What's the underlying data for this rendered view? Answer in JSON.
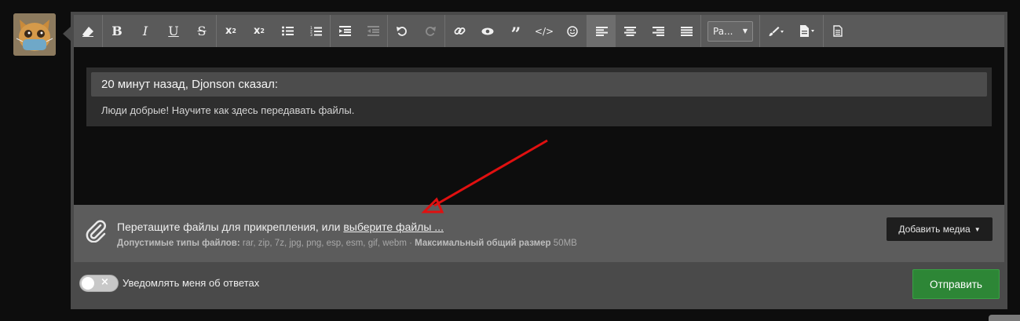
{
  "toolbar": {
    "paragraph_select": "Pa...",
    "icons": [
      "eraser-icon",
      "bold-icon",
      "italic-icon",
      "underline-icon",
      "strikethrough-icon",
      "superscript-icon",
      "subscript-icon",
      "bullet-list-icon",
      "numbered-list-icon",
      "indent-icon",
      "outdent-icon",
      "undo-icon",
      "redo-icon",
      "link-icon",
      "preview-icon",
      "quote-icon",
      "code-icon",
      "smiley-icon",
      "align-left-icon",
      "align-center-icon",
      "align-right-icon",
      "justify-icon",
      "paragraph-select",
      "brush-icon",
      "insert-icon",
      "document-icon"
    ]
  },
  "quote": {
    "header": "20 минут назад, Djonson сказал:",
    "body": "Люди добрые! Научите как здесь передавать файлы."
  },
  "attach": {
    "drag_text": "Перетащите файлы для прикрепления, или ",
    "choose_link": "выберите файлы ...",
    "allowed_label": "Допустимые типы файлов:",
    "allowed_types": " rar, zip, 7z, jpg, png, esp, esm, gif, webm · ",
    "max_label": "Максимальный общий размер",
    "max_value": " 50MB",
    "media_button": "Добавить медиа"
  },
  "footer": {
    "notify_label": "Уведомлять меня об ответах",
    "notify_toggle_on": false,
    "send_button": "Отправить"
  },
  "colors": {
    "send_green": "#2d8636",
    "arrow_red": "#e01010"
  }
}
